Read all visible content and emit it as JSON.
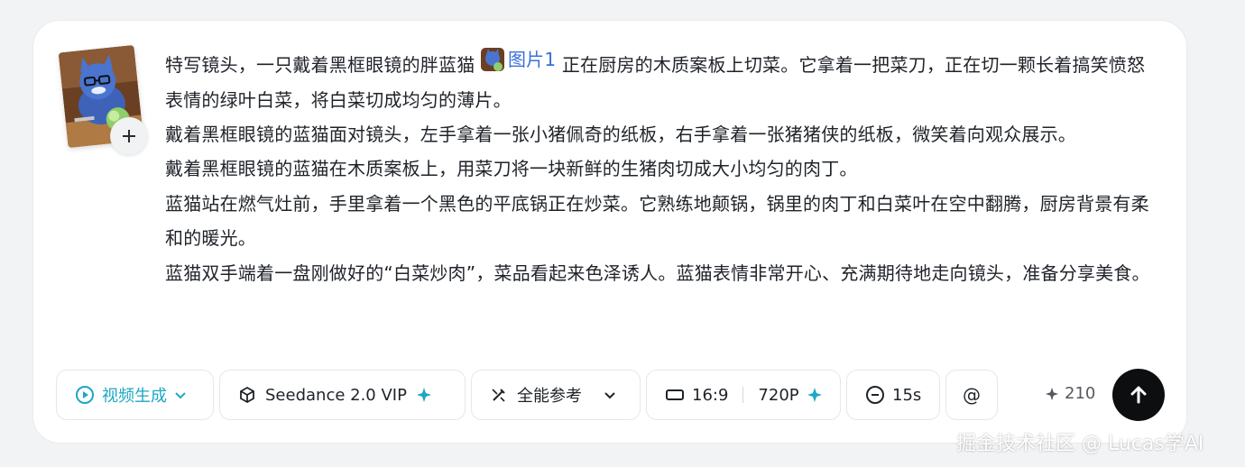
{
  "prompt": {
    "line1_before": "特写镜头，一只戴着黑框眼镜的胖蓝猫",
    "ref_label": "图片1",
    "line1_after": "正在厨房的木质案板上切菜。它拿着一把菜刀，正在切一颗长着搞笑愤怒表情的绿叶白菜，将白菜切成均匀的薄片。",
    "para2": "戴着黑框眼镜的蓝猫面对镜头，左手拿着一张小猪佩奇的纸板，右手拿着一张猪猪侠的纸板，微笑着向观众展示。",
    "para3": "戴着黑框眼镜的蓝猫在木质案板上，用菜刀将一块新鲜的生猪肉切成大小均匀的肉丁。",
    "para4": "蓝猫站在燃气灶前，手里拿着一个黑色的平底锅正在炒菜。它熟练地颠锅，锅里的肉丁和白菜叶在空中翻腾，厨房背景有柔和的暖光。",
    "para5": "蓝猫双手端着一盘刚做好的“白菜炒肉”，菜品看起来色泽诱人。蓝猫表情非常开心、充满期待地走向镜头，准备分享美食。"
  },
  "toolbar": {
    "mode_label": "视频生成",
    "model_label": "Seedance 2.0 VIP",
    "reference_label": "全能参考",
    "ratio_label": "16:9",
    "resolution_label": "720P",
    "duration_label": "15s",
    "at_label": "@",
    "cost": "210"
  },
  "watermark": "掘金技术社区 @ Lucas学AI",
  "colors": {
    "accent": "#1ea7c3",
    "link": "#3b6fd8",
    "send_bg": "#0d0e10"
  },
  "icons": {
    "mode": "video-play-icon",
    "model": "cube-icon",
    "reference": "magic-pen-icon",
    "ratio": "aspect-rect-icon",
    "duration": "timer-icon",
    "cost": "sparkle-icon",
    "send": "arrow-up-icon"
  }
}
